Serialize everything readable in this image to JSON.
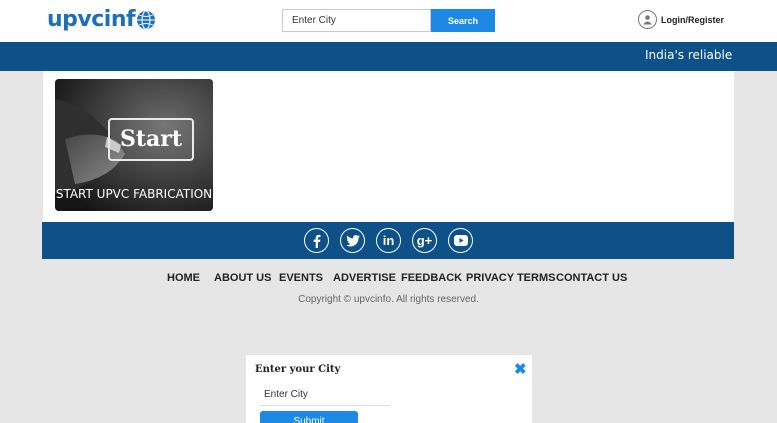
{
  "header": {
    "logo_text": "upvcinf",
    "search": {
      "placeholder": "Enter City",
      "button_label": "Search"
    },
    "login_label": "Login/Register"
  },
  "ticker": {
    "text": "India's reliable we"
  },
  "card": {
    "button_text": "Start",
    "caption": "START UPVC FABRICATION"
  },
  "social": {
    "icons": [
      "facebook-icon",
      "twitter-icon",
      "linkedin-icon",
      "google-plus-icon",
      "youtube-icon"
    ]
  },
  "footer": {
    "nav": [
      "HOME",
      "ABOUT US",
      "EVENTS",
      "ADVERTISE",
      "FEEDBACK",
      "PRIVACY TERMS",
      "CONTACT US"
    ],
    "copyright": "Copyright © upvcinfo. All rights reserved."
  },
  "modal": {
    "title": "Enter your City",
    "input_placeholder": "Enter City",
    "submit_label": "Submit"
  },
  "colors": {
    "brand_blue": "#0d5188",
    "accent_blue": "#1e88e5"
  }
}
